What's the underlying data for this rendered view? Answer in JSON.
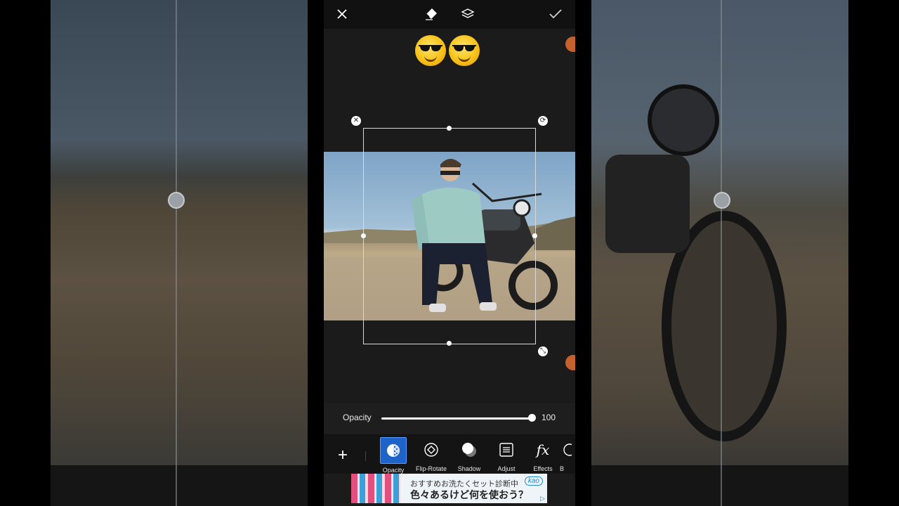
{
  "topbar": {
    "icons": [
      "close-icon",
      "eraser-icon",
      "layers-icon",
      "check-icon"
    ]
  },
  "stickers": {
    "emoji": "smiling-face-with-sunglasses",
    "count": 2
  },
  "opacity": {
    "label": "Opacity",
    "value": "100",
    "level": 1.0
  },
  "toolbar": {
    "add_label": "+",
    "tools": [
      {
        "label": "Opacity",
        "icon": "opacity-icon",
        "active": true
      },
      {
        "label": "Flip-Rotate",
        "icon": "flip-rotate-icon",
        "active": false
      },
      {
        "label": "Shadow",
        "icon": "shadow-icon",
        "active": false
      },
      {
        "label": "Adjust",
        "icon": "adjust-icon",
        "active": false
      },
      {
        "label": "Effects",
        "icon": "fx-icon",
        "active": false
      },
      {
        "label": "B",
        "icon": "blend-icon",
        "active": false
      }
    ]
  },
  "ad": {
    "line1": "おすすめお洗たくセット診断中",
    "line2": "色々あるけど何を使おう？",
    "brand": "kao"
  },
  "colors": {
    "accent": "#1e63c8",
    "brush": "#c5612d",
    "background": "#1b1b1b"
  }
}
